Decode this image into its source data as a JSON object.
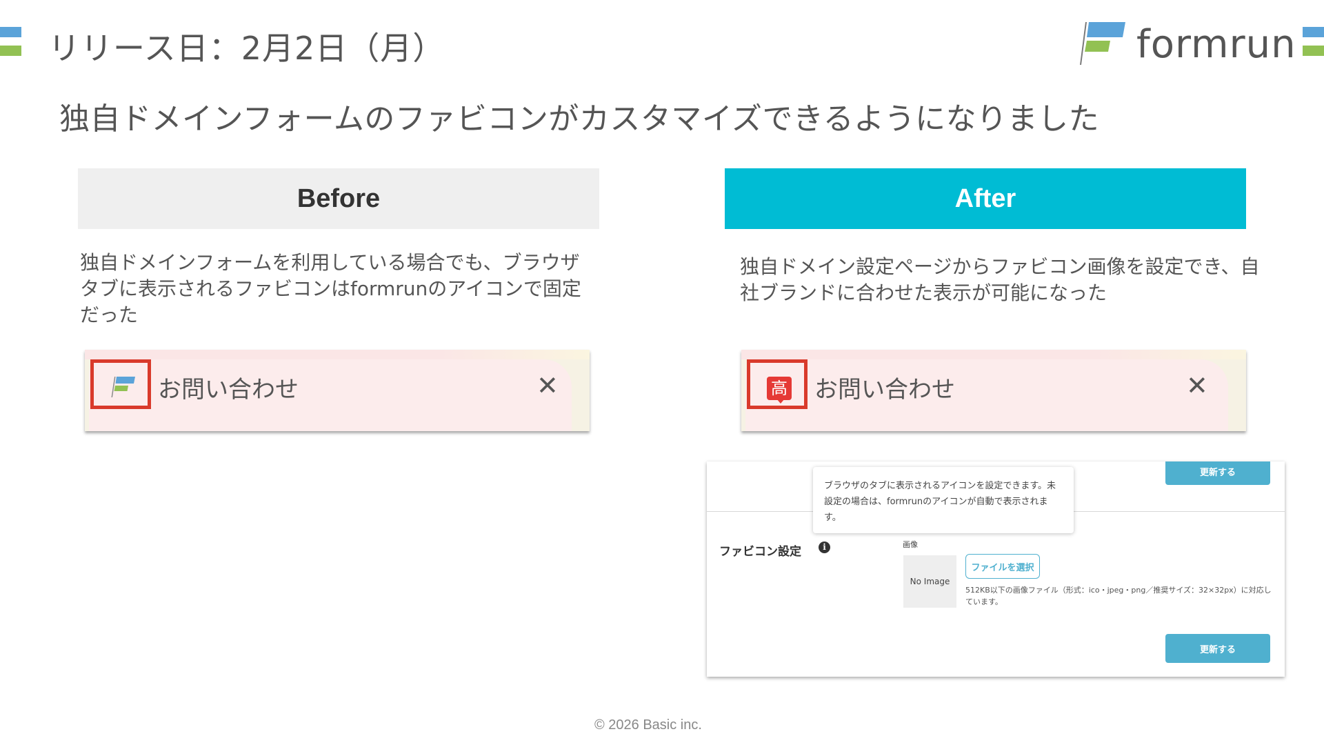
{
  "slide": {
    "release_date": "リリース日：2月2日（月）",
    "brand_name": "formrun",
    "headline": "独自ドメインフォームのファビコンがカスタマイズできるようになりました",
    "copyright": "© 2026 Basic inc.",
    "colors": {
      "accent_blue": "#5ba3d9",
      "accent_green": "#92c153",
      "after_header": "#00bcd4",
      "highlight_red": "#d93a2b"
    }
  },
  "before": {
    "header": "Before",
    "description": "独自ドメインフォームを利用している場合でも、ブラウザタブに表示されるファビコンはformrunのアイコンで固定だった",
    "tab": {
      "title": "お問い合わせ",
      "close": "✕",
      "favicon_icon": "formrun-logo-icon"
    }
  },
  "after": {
    "header": "After",
    "description": "独自ドメイン設定ページからファビコン画像を設定でき、自社ブランドに合わせた表示が可能になった",
    "tab": {
      "title": "お問い合わせ",
      "close": "✕",
      "favicon_icon": "custom-brand-icon",
      "favicon_char": "高"
    },
    "settings": {
      "update_top": "更新する",
      "tooltip": "ブラウザのタブに表示されるアイコンを設定できます。未設定の場合は、formrunのアイコンが自動で表示されます。",
      "favicon_label": "ファビコン設定",
      "info_icon": "i",
      "image_label": "画像",
      "no_image": "No Image",
      "file_button": "ファイルを選択",
      "file_note": "512KB以下の画像ファイル（形式：ico・jpeg・png／推奨サイズ：32×32px）に対応しています。",
      "update_bottom": "更新する"
    }
  }
}
